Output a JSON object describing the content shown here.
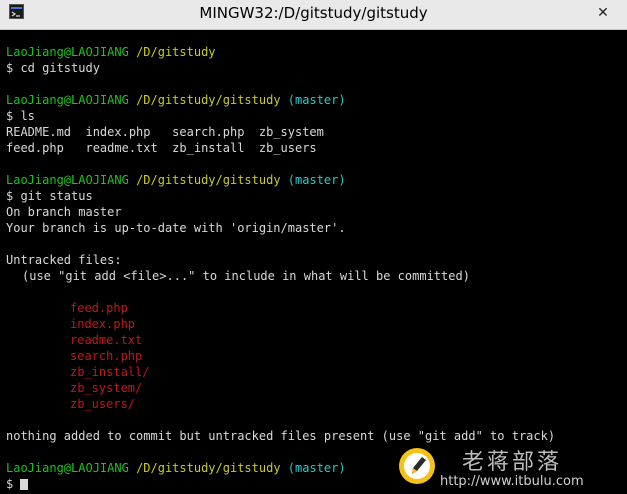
{
  "window": {
    "title": "MINGW32:/D/gitstudy/gitstudy",
    "close_glyph": "✕"
  },
  "terminal": {
    "prompt_user": "LaoJiang@LAOJIANG",
    "block1": {
      "path": "/D/gitstudy",
      "command": "$ cd gitstudy"
    },
    "block2": {
      "path": "/D/gitstudy/gitstudy",
      "branch": "(master)",
      "command": "$ ls",
      "output": [
        "README.md  index.php   search.php  zb_system",
        "feed.php   readme.txt  zb_install  zb_users"
      ]
    },
    "block3": {
      "path": "/D/gitstudy/gitstudy",
      "branch": "(master)",
      "command": "$ git status",
      "on_branch": "On branch master",
      "up_to_date": "Your branch is up-to-date with 'origin/master'.",
      "untracked_header": "Untracked files:",
      "untracked_hint": "(use \"git add <file>...\" to include in what will be committed)",
      "untracked_files": [
        "feed.php",
        "index.php",
        "readme.txt",
        "search.php",
        "zb_install/",
        "zb_system/",
        "zb_users/"
      ],
      "summary": "nothing added to commit but untracked files present (use \"git add\" to track)"
    },
    "block4": {
      "path": "/D/gitstudy/gitstudy",
      "branch": "(master)",
      "command": "$"
    }
  },
  "watermark": {
    "name": "老蒋部落",
    "url": "http://www.itbulu.com"
  },
  "colors": {
    "prompt_user": "#22c022",
    "prompt_path": "#c9c927",
    "prompt_branch": "#22c8c8",
    "untracked": "#c01818",
    "text": "#d9d9d9",
    "background": "#000000"
  },
  "icons": {
    "app": "mingw-terminal-icon",
    "close": "close-icon",
    "watermark_logo": "pencil-logo-icon"
  }
}
